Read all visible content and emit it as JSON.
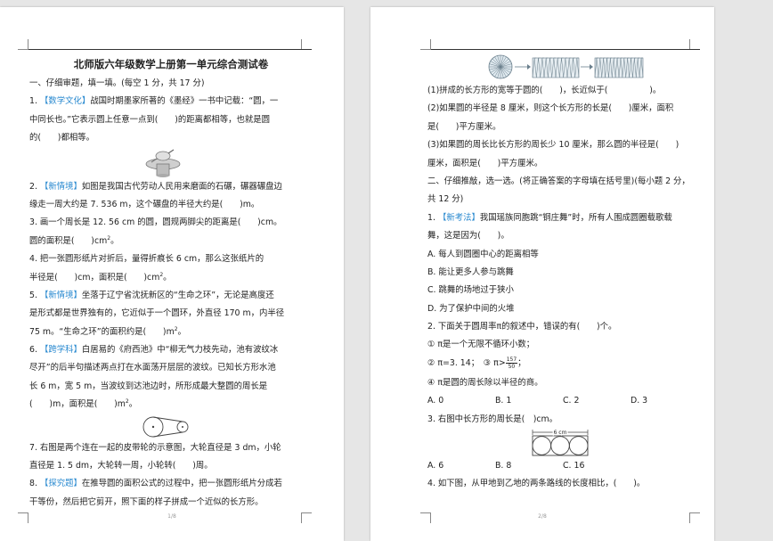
{
  "page1": {
    "title": "北师版六年级数学上册第一单元综合测试卷",
    "section1": "一、仔细审题，填一填。(每空 1 分，共 17 分)",
    "q1": {
      "num": "1. ",
      "tag": "【数学文化】",
      "l1": "战国时期墨家所著的《墨经》一书中记载：“圆，一",
      "l2": "中同长也。”它表示圆上任意一点到(　　)的距离都相等，也就是圆",
      "l3": "的(　　)都相等。"
    },
    "q2": {
      "num": "2. ",
      "tag": "【新情境】",
      "l1": "如图是我国古代劳动人民用来磨面的石碾，碾器碾盘边",
      "l2": "缘走一周大约是 7. 536 m，这个碾盘的半径大约是(　　)m。"
    },
    "q3": {
      "l1": "3. 画一个周长是 12. 56 cm 的圆，圆规两脚尖的距离是(　　)cm。",
      "l2a": "圆的面积是(　　)cm",
      "l2sup": "2",
      "l2b": "。"
    },
    "q4": {
      "l1": "4. 把一张圆形纸片对折后，量得折痕长 6 cm，那么这张纸片的",
      "l2a": "半径是(　　)cm，面积是(　　)cm",
      "l2sup": "2",
      "l2b": "。"
    },
    "q5": {
      "num": "5. ",
      "tag": "【新情境】",
      "l1": "坐落于辽宁省沈抚新区的“生命之环”，无论是高度还",
      "l2": "是形式都是世界独有的，它近似于一个圆环，外直径 170 m，内半径",
      "l3a": "75 m。“生命之环”的面积约是(　　)m",
      "l3sup": "2",
      "l3b": "。"
    },
    "q6": {
      "num": "6. ",
      "tag": "【跨学科】",
      "l1": "白居易的《府西池》中“柳无气力枝先动，池有波纹冰",
      "l2": "尽开”的后半句描述两点打在水面荡开层层的波纹。已知长方形水池",
      "l3": "长 6 m，宽 5 m，当波纹到达池边时，所形成最大整圆的周长是",
      "l4a": "(　　)m，面积是(　　)m",
      "l4sup": "2",
      "l4b": "。"
    },
    "q7": {
      "l1": "7. 右图是两个连在一起的皮带轮的示意图，大轮直径是 3 dm，小轮",
      "l2": "直径是 1. 5 dm，大轮转一周，小轮转(　　)周。"
    },
    "q8": {
      "num": "8. ",
      "tag": "【探究题】",
      "l1": "在推导圆的面积公式的过程中，把一张圆形纸片分成若",
      "l2": "干等份，然后把它剪开，照下面的样子拼成一个近似的长方形。"
    },
    "footer": "1/8"
  },
  "page2": {
    "q8a": "(1)拼成的长方形的宽等于圆的(　　)，长近似于(　　　　　)。",
    "q8b1": "(2)如果圆的半径是 8 厘米，则这个长方形的长是(　　)厘米，面积",
    "q8b2": "是(　　)平方厘米。",
    "q8c1": "(3)如果圆的周长比长方形的周长少 10 厘米，那么圆的半径是(　　)",
    "q8c2": "厘米，面积是(　　)平方厘米。",
    "section2_l1": "二、仔细推敲，选一选。(将正确答案的字母填在括号里)(每小题 2 分，",
    "section2_l2": "共 12 分)",
    "c1": {
      "num": "1. ",
      "tag": "【新考法】",
      "l1": "我国瑶族同胞跳“铜庄舞”时，所有人围成圆圈载歌载",
      "l2": "舞，这是因为(　　)。",
      "A": "A. 每人到圆圈中心的距离相等",
      "B": "B. 能让更多人参与跳舞",
      "C": "C. 跳舞的场地过于狭小",
      "D": "D. 为了保护中间的火堆"
    },
    "c2": {
      "l1": "2. 下面关于圆周率π的叙述中，错误的有(　　)个。",
      "s1": "① π是一个无限不循环小数；",
      "s2a": "② π=3. 14；　③ π>",
      "s2num": "157",
      "s2den": "50",
      "s2b": "；",
      "s4": "④ π是圆的周长除以半径的商。",
      "A": "A. 0",
      "B": "B. 1",
      "C": "C. 2",
      "D": "D. 3"
    },
    "c3": {
      "l1": "3. 右图中长方形的周长是(　)cm。",
      "fig_label": "6 cm",
      "A": "A. 6",
      "B": "B. 8",
      "C": "C. 16"
    },
    "c4": {
      "l1": "4. 如下图，从甲地到乙地的两条路线的长度相比，(　　)。"
    },
    "footer": "2/8"
  }
}
